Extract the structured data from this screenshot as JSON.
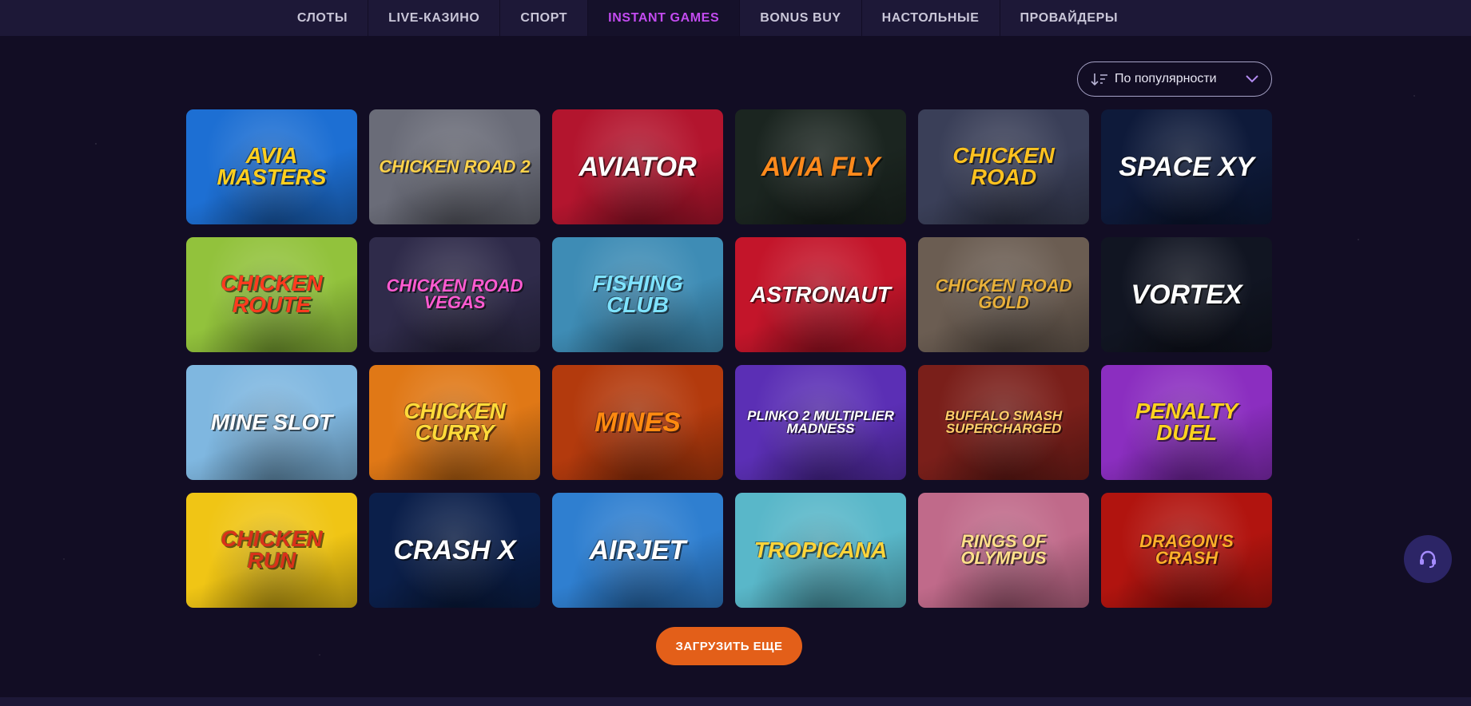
{
  "nav": {
    "tabs": [
      {
        "label": "СЛОТЫ",
        "active": false
      },
      {
        "label": "LIVE-КАЗИНО",
        "active": false
      },
      {
        "label": "СПОРТ",
        "active": false
      },
      {
        "label": "INSTANT GAMES",
        "active": true
      },
      {
        "label": "BONUS BUY",
        "active": false
      },
      {
        "label": "НАСТОЛЬНЫЕ",
        "active": false
      },
      {
        "label": "ПРОВАЙДЕРЫ",
        "active": false
      }
    ]
  },
  "sort": {
    "icon": "sort-descending-icon",
    "selected": "По популярности",
    "chevron": "chevron-down-icon"
  },
  "games": [
    {
      "title": "AVIA MASTERS",
      "bg": "#1d6fd3",
      "fg": "#ffcf1f"
    },
    {
      "title": "CHICKEN ROAD 2",
      "bg": "#6a6c78",
      "fg": "#ffd24a"
    },
    {
      "title": "Aviator",
      "bg": "#b3152e",
      "fg": "#ffffff"
    },
    {
      "title": "AVIA FLY",
      "bg": "#1b2520",
      "fg": "#ff8a1c"
    },
    {
      "title": "CHICKEN ROAD",
      "bg": "#3a3f58",
      "fg": "#ffc21f"
    },
    {
      "title": "SPACE XY",
      "bg": "#0e1a3a",
      "fg": "#ffffff"
    },
    {
      "title": "CHICKEN ROUTE",
      "bg": "#92c23c",
      "fg": "#ff3b1f"
    },
    {
      "title": "CHICKEN ROAD Vegas",
      "bg": "#2f2b4a",
      "fg": "#ff5bd1"
    },
    {
      "title": "FISHING CLUB",
      "bg": "#3e8cb5",
      "fg": "#7fe3ff"
    },
    {
      "title": "Astronaut",
      "bg": "#c3152a",
      "fg": "#ffffff"
    },
    {
      "title": "CHICKEN ROAD Gold",
      "bg": "#6b5d52",
      "fg": "#e8b03a"
    },
    {
      "title": "VORTEX",
      "bg": "#111522",
      "fg": "#ffffff"
    },
    {
      "title": "MINE SLOT",
      "bg": "#7fb7e0",
      "fg": "#ffffff"
    },
    {
      "title": "CHICKEN CURRY",
      "bg": "#e07816",
      "fg": "#ffdb3a"
    },
    {
      "title": "MINES",
      "bg": "#b33a0d",
      "fg": "#ff8a10"
    },
    {
      "title": "PLINKO 2 MULTIPLIER MADNESS",
      "bg": "#5b2fb5",
      "fg": "#ffffff"
    },
    {
      "title": "BUFFALO SMASH SUPERCHARGED",
      "bg": "#7a1f1a",
      "fg": "#ffcf6a"
    },
    {
      "title": "PENALTY DUEL",
      "bg": "#8b2ec0",
      "fg": "#ffd21f"
    },
    {
      "title": "CHICKEN RUN",
      "bg": "#f0c515",
      "fg": "#d8321a"
    },
    {
      "title": "CRASH X",
      "bg": "#0b1f4a",
      "fg": "#ffffff"
    },
    {
      "title": "AIRJET",
      "bg": "#2f7fd0",
      "fg": "#ffffff"
    },
    {
      "title": "TROPICANA",
      "bg": "#59b7c9",
      "fg": "#ffd43a"
    },
    {
      "title": "RINGS OF OLYMPUS",
      "bg": "#c06a8a",
      "fg": "#ffe08a"
    },
    {
      "title": "DRAGON'S CRASH",
      "bg": "#b1140f",
      "fg": "#ffb02a"
    }
  ],
  "load_more": {
    "label": "ЗАГРУЗИТЬ ЕЩЕ",
    "color": "#e35f19"
  },
  "support": {
    "icon": "headset-icon"
  },
  "colors": {
    "background": "#120d24",
    "nav_bg": "#1d1837",
    "accent": "#c34bf0"
  }
}
